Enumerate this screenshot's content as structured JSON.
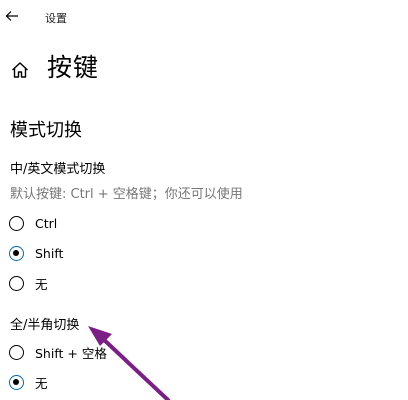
{
  "window": {
    "title": "设置"
  },
  "page": {
    "title": "按键"
  },
  "section": {
    "title": "模式切换"
  },
  "group1": {
    "title": "中/英文模式切换",
    "description": "默认按键: Ctrl + 空格键；你还可以使用",
    "options": [
      {
        "label": "Ctrl",
        "checked": false
      },
      {
        "label": "Shift",
        "checked": true
      },
      {
        "label": "无",
        "checked": false
      }
    ]
  },
  "group2": {
    "title": "全/半角切换",
    "options": [
      {
        "label": "Shift + 空格",
        "checked": false
      },
      {
        "label": "无",
        "checked": true
      }
    ]
  },
  "colors": {
    "accent": "#0067c0",
    "annotation_arrow": "#7b1e85",
    "secondary_text": "#777777"
  }
}
